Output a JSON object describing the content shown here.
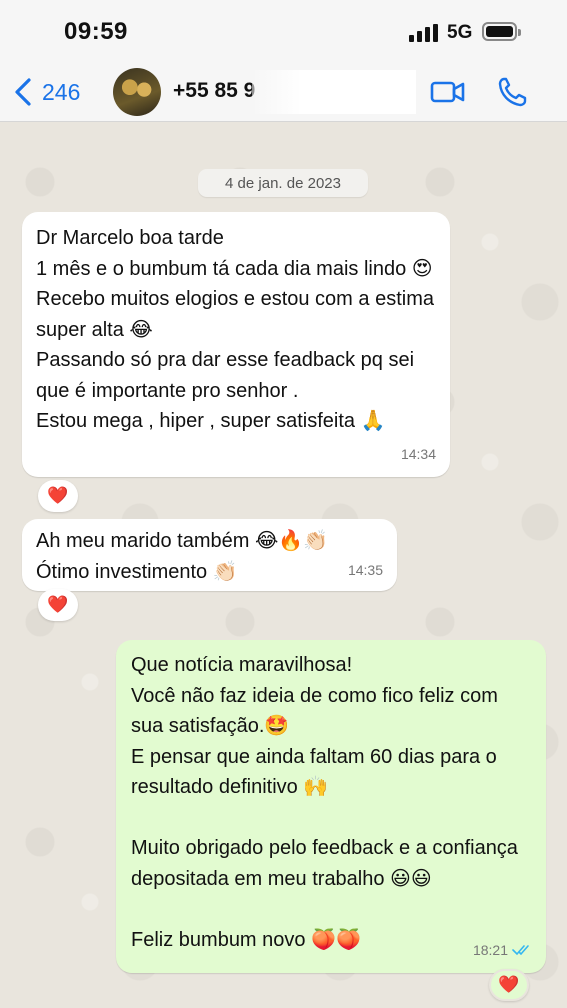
{
  "status_bar": {
    "time": "09:59",
    "network": "5G"
  },
  "header": {
    "back_count": "246",
    "contact_name": "+55 85 9"
  },
  "chat": {
    "date_label": "4 de jan. de 2023",
    "messages": [
      {
        "direction": "incoming",
        "text": "Dr Marcelo boa tarde\n1 mês e o bumbum tá cada dia mais lindo 😍\nRecebo muitos elogios e estou com a estima super alta 😂\nPassando só pra dar esse feadback pq sei que é importante pro senhor .\nEstou mega , hiper , super satisfeita 🙏",
        "time": "14:34",
        "reaction": "❤️"
      },
      {
        "direction": "incoming",
        "text": "Ah meu marido também 😂🔥👏🏻\nÓtimo investimento 👏🏻",
        "time": "14:35",
        "reaction": "❤️"
      },
      {
        "direction": "outgoing",
        "text": "Que notícia maravilhosa!\nVocê não faz ideia de como fico feliz com sua satisfação.🤩\nE pensar que ainda faltam 60 dias para o resultado definitivo 🙌\n\nMuito obrigado pelo feedback e a confiança depositada em meu trabalho 😃😃\n\nFeliz bumbum novo 🍑🍑",
        "time": "18:21",
        "reaction": "❤️"
      }
    ]
  },
  "colors": {
    "accent": "#1a73e8",
    "incoming_bubble": "#ffffff",
    "outgoing_bubble": "#e2fbd0",
    "read_ticks": "#34b7f1"
  },
  "icons": {
    "back": "chevron-left-icon",
    "video": "video-camera-icon",
    "call": "phone-icon",
    "signal": "signal-bars-icon",
    "battery": "battery-icon"
  }
}
